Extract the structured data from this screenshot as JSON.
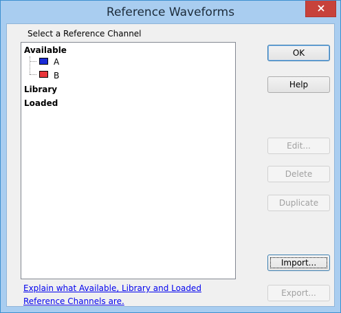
{
  "window": {
    "title": "Reference Waveforms"
  },
  "panel": {
    "heading": "Select a Reference Channel",
    "tree": {
      "available": "Available",
      "children": [
        {
          "label": "A",
          "color": "#1a2bd6"
        },
        {
          "label": "B",
          "color": "#e8353a"
        }
      ],
      "library": "Library",
      "loaded": "Loaded"
    },
    "help_link_line1": "Explain what Available, Library and Loaded",
    "help_link_line2": "Reference Channels are."
  },
  "buttons": {
    "ok": "OK",
    "help": "Help",
    "edit": "Edit...",
    "delete": "Delete",
    "duplicate": "Duplicate",
    "import": "Import...",
    "export": "Export..."
  },
  "colors": {
    "titlebar": "#a9cdf0",
    "close": "#c7423b",
    "link": "#0000ee"
  }
}
